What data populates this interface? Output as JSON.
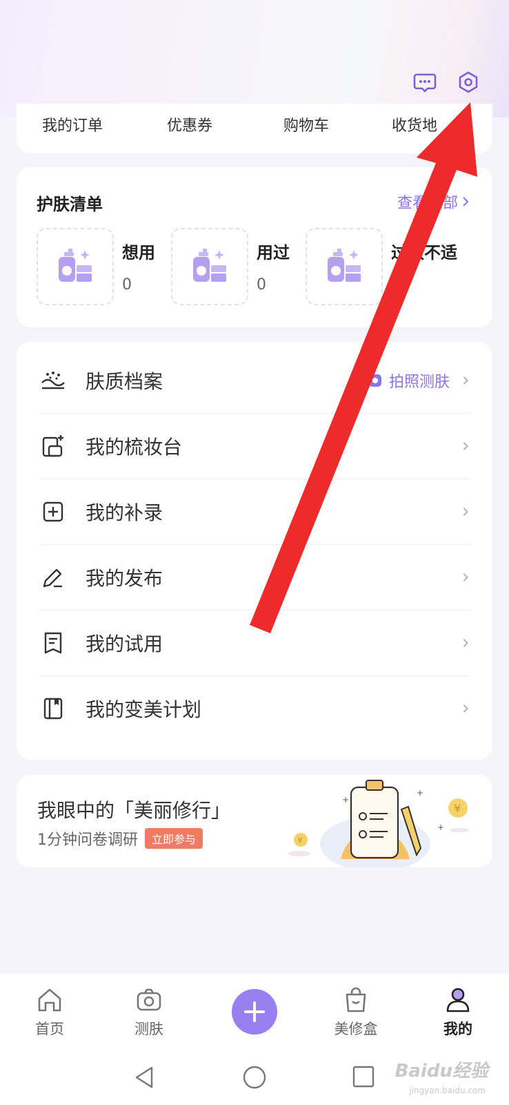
{
  "header": {
    "message_icon": "message-dots-icon",
    "settings_icon": "settings-hex-icon"
  },
  "orders": {
    "items": [
      "我的订单",
      "优惠券",
      "购物车",
      "收货地"
    ]
  },
  "skincare_list": {
    "title": "护肤清单",
    "view_all": "查看全部",
    "items": [
      {
        "name": "想用",
        "count": "0"
      },
      {
        "name": "用过",
        "count": "0"
      },
      {
        "name": "过敏不适",
        "count": "0"
      }
    ]
  },
  "menu": {
    "items": [
      {
        "label": "肤质档案",
        "icon": "skin-profile-icon",
        "extra": "拍照测肤"
      },
      {
        "label": "我的梳妆台",
        "icon": "vanity-icon"
      },
      {
        "label": "我的补录",
        "icon": "plus-square-icon"
      },
      {
        "label": "我的发布",
        "icon": "pencil-icon"
      },
      {
        "label": "我的试用",
        "icon": "trial-doc-icon"
      },
      {
        "label": "我的变美计划",
        "icon": "notebook-icon"
      }
    ]
  },
  "survey": {
    "title": "我眼中的「美丽修行」",
    "subtitle": "1分钟问卷调研",
    "badge": "立即参与"
  },
  "bottom_nav": {
    "items": [
      {
        "label": "首页",
        "icon": "home-icon"
      },
      {
        "label": "测肤",
        "icon": "camera-icon"
      },
      {
        "label": "美修盒",
        "icon": "shopping-bag-icon"
      },
      {
        "label": "我的",
        "icon": "user-icon"
      }
    ],
    "active": "我的"
  },
  "watermark": {
    "text": "Baidu经验",
    "sub": "jingyan.baidu.com"
  },
  "colors": {
    "accent": "#8e73e0",
    "add_button": "#9a7ff0",
    "badge": "#f07a62",
    "arrow": "#ee2b2b"
  }
}
